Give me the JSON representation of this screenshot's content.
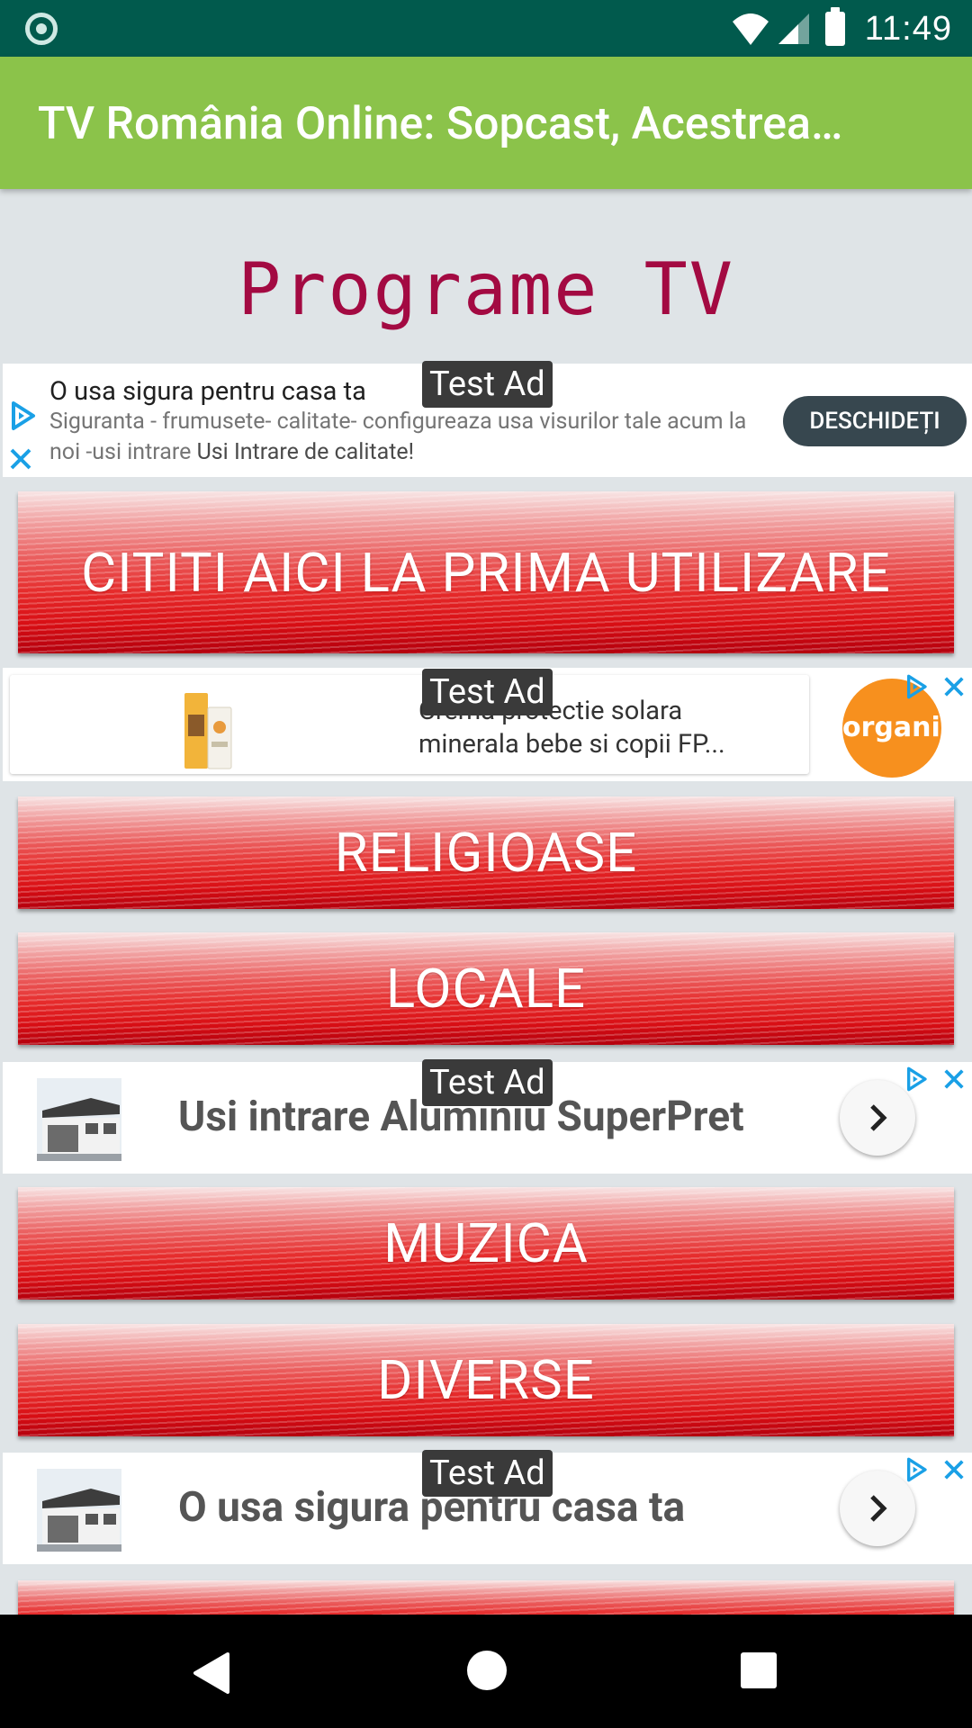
{
  "status_bar": {
    "time": "11:49"
  },
  "app_bar": {
    "title": "TV România Online: Sopcast, Acestrea…"
  },
  "heading": "Programe TV",
  "ads": {
    "badge": "Test Ad",
    "ad1": {
      "title": "O usa sigura pentru casa ta",
      "desc_main": "Siguranta - frumusete- calitate- configureaza usa visurilor tale acum la noi -usi intrare ",
      "desc_link": "Usi Intrare de calitate!",
      "button": "DESCHIDEȚI"
    },
    "ad2": {
      "text_line1": "Crema protectie solara",
      "text_line2": "minerala bebe si copii FP...",
      "logo": "organik"
    },
    "ad3": {
      "title": "Usi intrare Aluminiu SuperPret"
    },
    "ad4": {
      "title": "O usa sigura pentru casa ta"
    }
  },
  "buttons": {
    "first_use": "CITITI AICI LA PRIMA UTILIZARE",
    "religious": "RELIGIOASE",
    "local": "LOCALE",
    "music": "MUZICA",
    "misc": "DIVERSE"
  },
  "colors": {
    "status_bar": "#015a4d",
    "app_bar": "#8bc34a",
    "heading": "#a30a42",
    "button_red": "#e62b2b",
    "ad_button": "#37474f",
    "ad_choices": "#1aa0e6"
  },
  "icons": {
    "status": [
      "notification-dot-icon",
      "wifi-icon",
      "cell-signal-icon",
      "battery-icon"
    ],
    "ads": [
      "ad-choices-icon",
      "close-icon",
      "chevron-right-icon"
    ],
    "nav": [
      "back-icon",
      "home-icon",
      "recents-icon"
    ]
  }
}
